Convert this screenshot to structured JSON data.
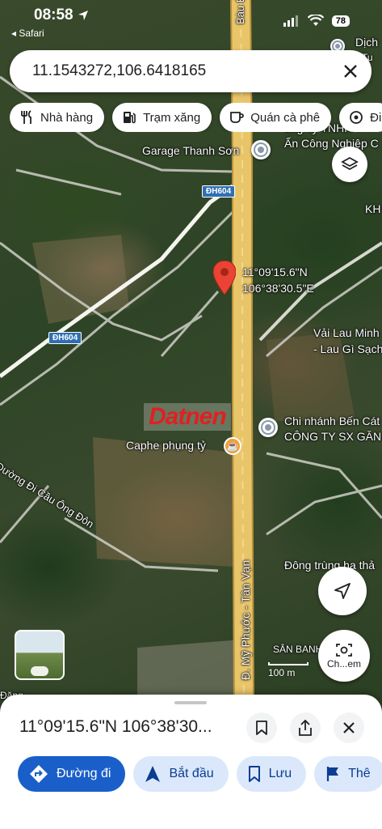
{
  "status_bar": {
    "time": "08:58",
    "back_app": "◂ Safari",
    "battery": "78"
  },
  "search": {
    "query": "11.1543272,106.6418165"
  },
  "chips": [
    {
      "label": "Nhà hàng",
      "icon": "restaurant-icon"
    },
    {
      "label": "Trạm xăng",
      "icon": "gas-station-icon"
    },
    {
      "label": "Quán cà phê",
      "icon": "coffee-icon"
    },
    {
      "label": "Đi",
      "icon": "attraction-icon"
    }
  ],
  "map": {
    "labels": {
      "garage": "Garage Thanh Sơn",
      "company_top": "Ấn Công Nghiệp C",
      "company_top2": "ông Ty TNHH",
      "dich": "Dịch",
      "dich2": "Tu",
      "kh": "KH",
      "pin_coord1": "11°09'15.6\"N",
      "pin_coord2": "106°38'30.5\"E",
      "vai_lau1": "Vải Lau Minh",
      "vai_lau2": "- Lau Gì Sạch",
      "branch1": "Chi nhánh Bến Cát",
      "branch2": "CÔNG TY SX GĂN",
      "caphe": "Caphe phụng tỷ",
      "dong_trung": "Đông trùng hạ thả",
      "road_vertical_top": "Bàu Bàng",
      "road_vertical": "Đ. Mỹ Phước - Tân Vạn",
      "road_cau": "Đường Đi Cầu Ông Đôn",
      "san_banh": "SÂN BANH",
      "dang": "Đăng",
      "camera_label": "Ch...em"
    },
    "route_badges": [
      "ĐH604",
      "ĐH604"
    ],
    "watermark": "Datnen",
    "scale": "100 m"
  },
  "sheet": {
    "title": "11°09'15.6\"N 106°38'30..."
  },
  "actions": [
    {
      "label": "Đường đi",
      "icon": "directions-icon"
    },
    {
      "label": "Bắt đầu",
      "icon": "navigation-icon"
    },
    {
      "label": "Lưu",
      "icon": "bookmark-icon"
    },
    {
      "label": "Thê",
      "icon": "flag-icon"
    }
  ],
  "colors": {
    "primary": "#1a5fc9",
    "pin": "#ea4335",
    "road": "#e9c56a"
  }
}
